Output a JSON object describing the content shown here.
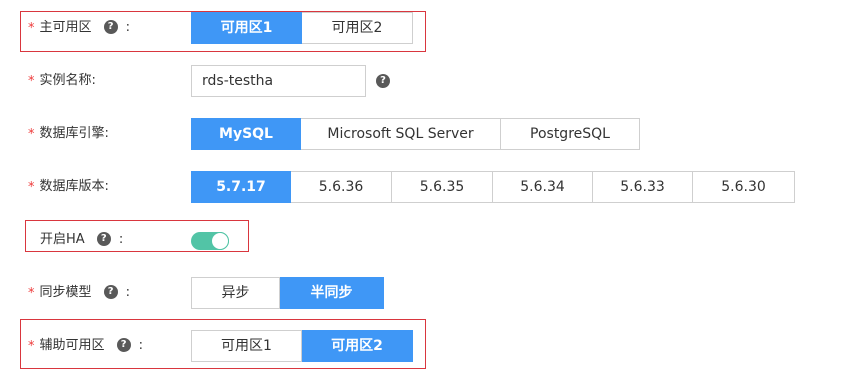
{
  "form": {
    "primary_zone": {
      "label": "主可用区",
      "required_mark": "*",
      "colon": ":",
      "help_icon": "question-circle-icon",
      "options": [
        "可用区1",
        "可用区2"
      ],
      "selected": "可用区1"
    },
    "instance_name": {
      "label": "实例名称:",
      "required_mark": "*",
      "value": "rds-testha",
      "help_icon": "question-circle-icon"
    },
    "db_engine": {
      "label": "数据库引擎:",
      "required_mark": "*",
      "options": [
        "MySQL",
        "Microsoft SQL Server",
        "PostgreSQL"
      ],
      "selected": "MySQL"
    },
    "db_version": {
      "label": "数据库版本:",
      "required_mark": "*",
      "options": [
        "5.7.17",
        "5.6.36",
        "5.6.35",
        "5.6.34",
        "5.6.33",
        "5.6.30"
      ],
      "selected": "5.7.17"
    },
    "enable_ha": {
      "label": "开启HA",
      "colon": ":",
      "help_icon": "question-circle-icon",
      "on": true
    },
    "sync_mode": {
      "label": "同步模型",
      "required_mark": "*",
      "colon": ":",
      "help_icon": "question-circle-icon",
      "options": [
        "异步",
        "半同步"
      ],
      "selected": "半同步"
    },
    "secondary_zone": {
      "label": "辅助可用区",
      "required_mark": "*",
      "colon": ":",
      "help_icon": "question-circle-icon",
      "options": [
        "可用区1",
        "可用区2"
      ],
      "selected": "可用区2"
    }
  },
  "colors": {
    "accent": "#3f97f6",
    "toggle_on": "#52c4a6",
    "required": "#ee3b3b",
    "highlight_box": "#d9363e"
  }
}
